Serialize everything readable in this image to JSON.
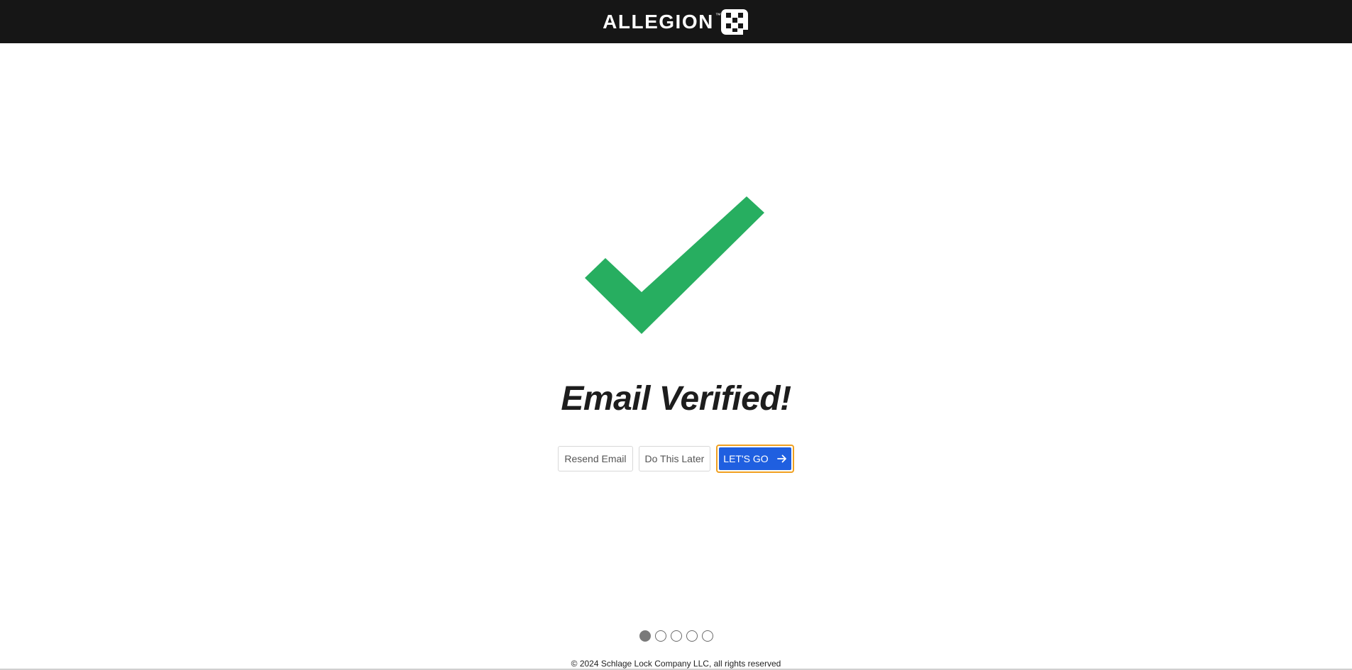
{
  "header": {
    "brand_name": "ALLEGION",
    "brand_tm": "™",
    "logo_icon": "allegion-logo-icon"
  },
  "main": {
    "status_icon": "checkmark-icon",
    "status_color": "#27ae60",
    "title": "Email Verified!",
    "buttons": {
      "resend_label": "Resend Email",
      "later_label": "Do This Later",
      "go_label": "LET'S GO",
      "go_icon": "arrow-right-icon",
      "go_color": "#1f5fe0",
      "focus_ring_color": "#f0a020"
    }
  },
  "pagination": {
    "total": 5,
    "active_index": 0
  },
  "footer": {
    "copyright": "© 2024 Schlage Lock Company LLC, all rights reserved"
  }
}
